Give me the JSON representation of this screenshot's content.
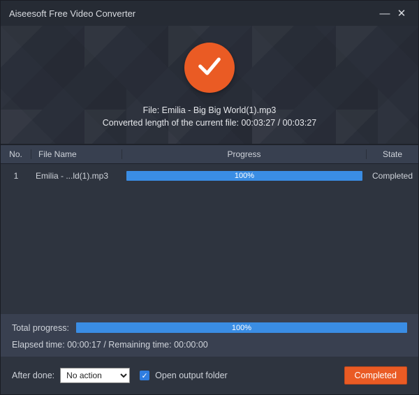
{
  "title": "Aiseesoft Free Video Converter",
  "banner": {
    "file_line": "File: Emilia - Big Big World(1).mp3",
    "length_line": "Converted length of the current file: 00:03:27 / 00:03:27"
  },
  "columns": {
    "no": "No.",
    "name": "File Name",
    "progress": "Progress",
    "state": "State"
  },
  "rows": [
    {
      "no": "1",
      "name": "Emilia - ...ld(1).mp3",
      "progress_pct": "100%",
      "state": "Completed"
    }
  ],
  "total": {
    "label": "Total progress:",
    "pct": "100%",
    "times": "Elapsed time: 00:00:17 / Remaining time: 00:00:00"
  },
  "actions": {
    "after_done_label": "After done:",
    "after_done_value": "No action",
    "open_output_label": "Open output folder",
    "completed_btn": "Completed"
  }
}
